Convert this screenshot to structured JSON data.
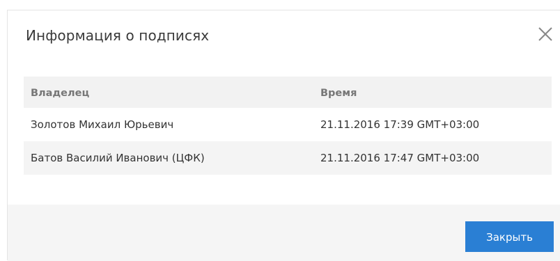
{
  "dialog": {
    "title": "Информация о подписях",
    "close_icon": "close-icon",
    "close_button_label": "Закрыть"
  },
  "table": {
    "columns": [
      "Владелец",
      "Время"
    ],
    "rows": [
      {
        "owner": "Золотов Михаил Юрьевич",
        "time": "21.11.2016 17:39 GMT+03:00"
      },
      {
        "owner": "Батов Василий Иванович (ЦФК)",
        "time": "21.11.2016 17:47 GMT+03:00"
      }
    ]
  },
  "colors": {
    "primary_button": "#2a7fd4",
    "header_bg": "#f2f2f2",
    "footer_bg": "#f5f5f5"
  }
}
